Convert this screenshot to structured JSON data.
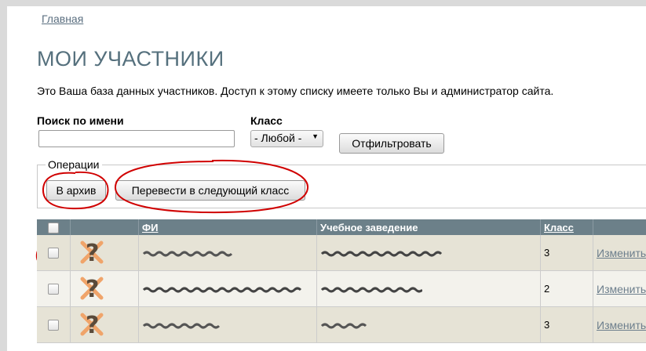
{
  "breadcrumb": {
    "home": "Главная"
  },
  "page": {
    "title": "МОИ УЧАСТНИКИ",
    "description": "Это Ваша база данных участников. Доступ к этому списку имеете только Вы и администратор сайта."
  },
  "filters": {
    "search_label": "Поиск по имени",
    "search_value": "",
    "class_label": "Класс",
    "class_selected": "- Любой -",
    "filter_button": "Отфильтровать"
  },
  "operations": {
    "legend": "Операции",
    "archive_button": "В архив",
    "promote_button": "Перевести в следующий класс"
  },
  "table": {
    "columns": {
      "name": "ФИ",
      "school": "Учебное заведение",
      "class": "Класс"
    },
    "rows": [
      {
        "class": "3",
        "edit": "Изменить"
      },
      {
        "class": "2",
        "edit": "Изменить"
      },
      {
        "class": "3",
        "edit": "Изменить"
      }
    ]
  },
  "colors": {
    "header_bg": "#6c8089",
    "title": "#55707d",
    "annotation_red": "#d00000",
    "row_odd": "#e6e3d6",
    "row_even": "#f3f2ec"
  }
}
